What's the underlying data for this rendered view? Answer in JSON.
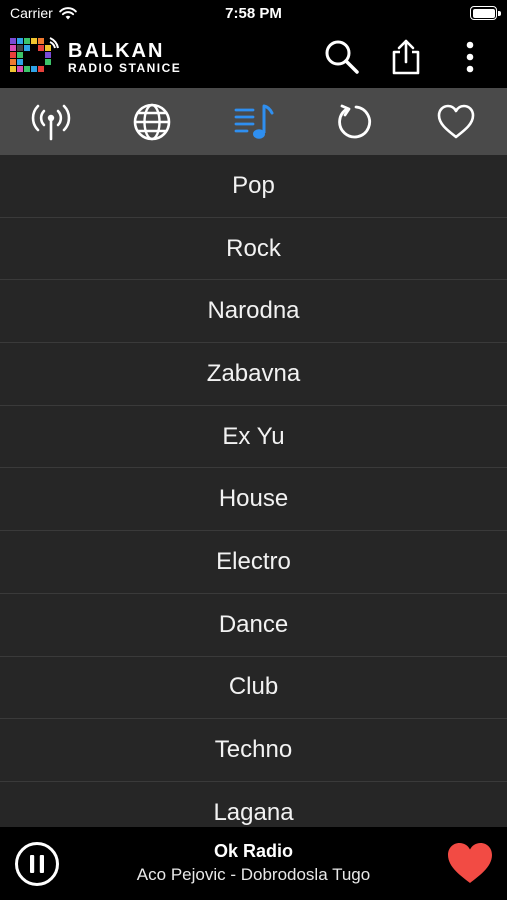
{
  "status_bar": {
    "carrier": "Carrier",
    "time": "7:58 PM"
  },
  "header": {
    "logo_line1": "BALKAN",
    "logo_line2": "RADIO STANICE",
    "actions": [
      "search-icon",
      "share-icon",
      "more-vertical-icon"
    ]
  },
  "tabs": [
    {
      "icon": "broadcast-icon",
      "active": false
    },
    {
      "icon": "globe-icon",
      "active": false
    },
    {
      "icon": "music-list-icon",
      "active": true
    },
    {
      "icon": "history-icon",
      "active": false
    },
    {
      "icon": "heart-outline-icon",
      "active": false
    }
  ],
  "genres": [
    "Pop",
    "Rock",
    "Narodna",
    "Zabavna",
    "Ex Yu",
    "House",
    "Electro",
    "Dance",
    "Club",
    "Techno",
    "Lagana"
  ],
  "player": {
    "station": "Ok Radio",
    "track": "Aco Pejovic - Dobrodosla Tugo"
  },
  "colors": {
    "accent": "#2f8ff0",
    "favorite": "#f24b44",
    "tab_bar": "#4a4a4a",
    "list_bg": "#262626"
  }
}
